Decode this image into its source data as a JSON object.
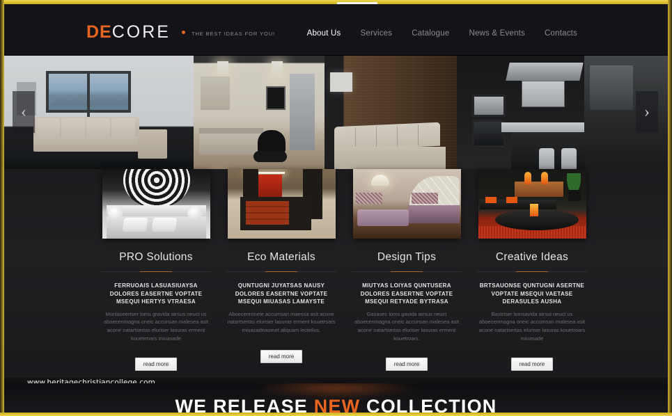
{
  "browser": {
    "frame_color": "#d4b82e",
    "tab_marker": ""
  },
  "header": {
    "logo": {
      "part1": "DE",
      "part2": "CORE",
      "dot": "bullet-icon"
    },
    "tagline": "THE BEST IDEAS FOR YOU!",
    "nav": [
      {
        "label": "About Us",
        "active": true
      },
      {
        "label": "Services",
        "active": false
      },
      {
        "label": "Catalogue",
        "active": false
      },
      {
        "label": "News & Events",
        "active": false
      },
      {
        "label": "Contacts",
        "active": false
      }
    ]
  },
  "hero": {
    "prev_arrow": "‹",
    "next_arrow": "›",
    "slides": [
      {
        "alt": "living-room-with-mountain-view-window"
      },
      {
        "alt": "modern-kitchen-with-pendant-lights"
      },
      {
        "alt": "brown-textured-wall-with-white-sofa"
      },
      {
        "alt": "dark-kitchen-with-island"
      },
      {
        "alt": "dark-cabinetry"
      }
    ]
  },
  "features": [
    {
      "thumb": "black-and-white-bedroom",
      "title": "PRO Solutions",
      "headline": "FERRUOAIS LASUASIUAYSA DOLORES EASERTNE VOPTATE MSEQUI HERTYS VTRAESA",
      "body": "Monlaseertser loms gravida atrsus neuct us aboecenmagna oneic accunsan malesea asit acone natartsertas eluriser lasuras erment kouetrmars miuasade",
      "button": "read more"
    },
    {
      "thumb": "red-wood-reception-desk",
      "title": "Eco Materials",
      "headline": "QUNTUGNI  JUYATSAS NAUSY DOLORES EASERTNE VOPTATE MSEQUI MIUASAS LAMAYSTE",
      "body": "Aboecenronele accumsan maessa asit acone natartsertas eluriser lasuras erment kouetrsars miuasadeaomet aliquam lectellus.",
      "button": "read more"
    },
    {
      "thumb": "purple-lounge-arched-window",
      "title": "Design Tips",
      "headline": "MIUTYAS LOIYAS QUNTUSERA DOLORES EASERTNE VOPTATE MSEQUI RETYADE BYTRASA",
      "body": "Gasasec loms gavida atrsus neuct aboecenmagna oneic accunsan malesea asit acone natartsertas eluriser lasuras erment kouetroars.",
      "button": "read more"
    },
    {
      "thumb": "orange-living-room-red-rug",
      "title": "Creative Ideas",
      "headline": "BRTSAUONSE QUNTUGNI ASERTNE VOPTATE MSEQUI VAETASE DERASULES AUSHA",
      "body": "Bastrtser lomsavida atrsui neuct us aboecenmagna oneic accumsan malesea asit acone natartsertas eluriser lasuras kouetroars miuasade",
      "button": "read more"
    }
  ],
  "watermark": "www.heritagechristiancollege.com",
  "banner": {
    "text_before": "WE RELEASE ",
    "text_highlight": "NEW",
    "text_after": " COLLECTION",
    "highlight_color": "#e8651f"
  }
}
